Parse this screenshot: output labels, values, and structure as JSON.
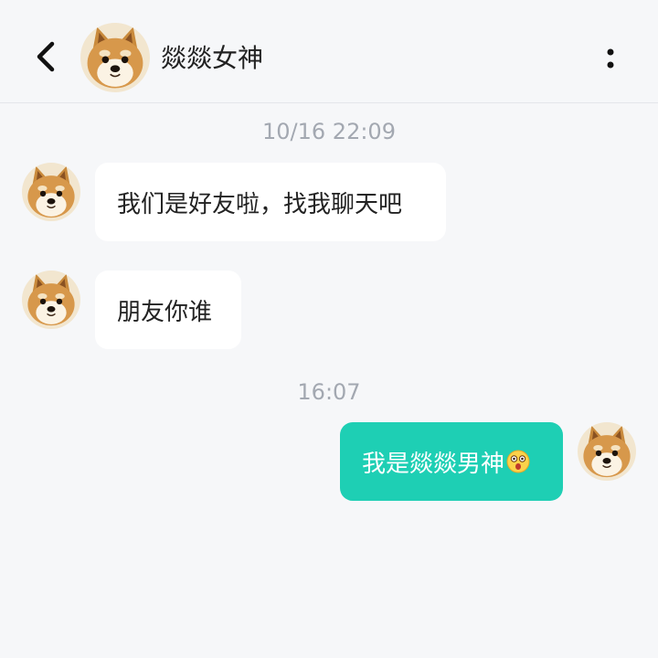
{
  "header": {
    "title": "燚燚女神",
    "back_icon": "back-arrow-icon",
    "more_icon": "more-vertical-icon"
  },
  "messages": [
    {
      "type": "timestamp",
      "text": "10/16  22:09"
    },
    {
      "type": "incoming",
      "text": "我们是好友啦，找我聊天吧"
    },
    {
      "type": "incoming",
      "text": "朋友你谁"
    },
    {
      "type": "timestamp",
      "text": "16:07"
    },
    {
      "type": "outgoing",
      "text": "我是燚燚男神",
      "emoji": "dizzy-face-emoji"
    }
  ],
  "colors": {
    "background": "#f6f7f9",
    "incoming_bubble": "#ffffff",
    "outgoing_bubble": "#1ecfb4",
    "timestamp": "#a3a8b1"
  }
}
